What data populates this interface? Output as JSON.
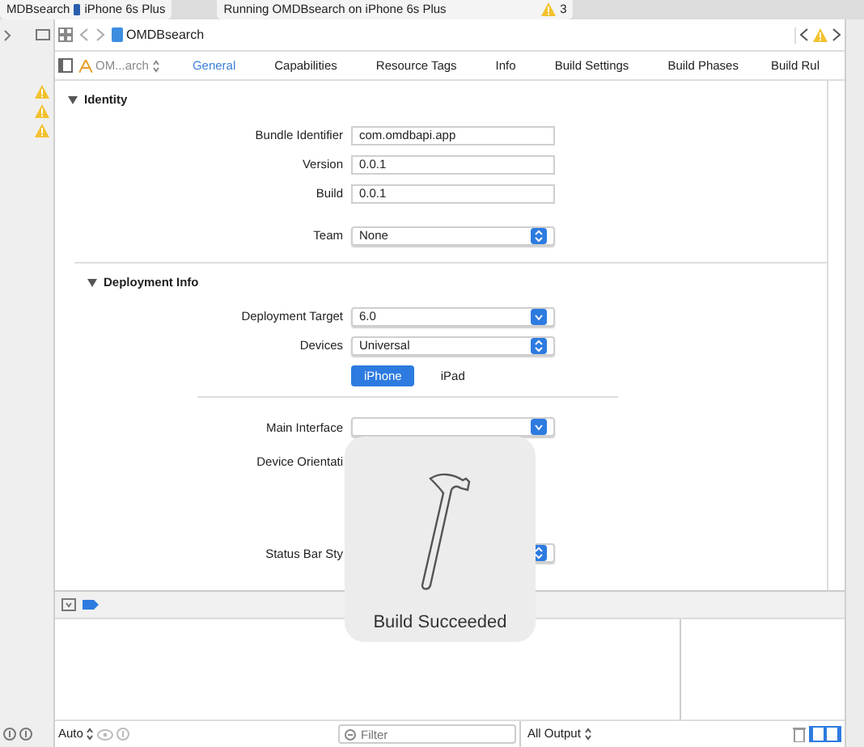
{
  "top_bar": {
    "scheme": "MDBsearch",
    "device": "iPhone 6s Plus",
    "activity": "Running OMDBsearch on iPhone 6s Plus",
    "warning_count": "3"
  },
  "jump_bar": {
    "file": "OMDBsearch"
  },
  "target_selector": "OM...arch",
  "tabs": [
    {
      "label": "General",
      "selected": true
    },
    {
      "label": "Capabilities",
      "selected": false
    },
    {
      "label": "Resource Tags",
      "selected": false
    },
    {
      "label": "Info",
      "selected": false
    },
    {
      "label": "Build Settings",
      "selected": false
    },
    {
      "label": "Build Phases",
      "selected": false
    },
    {
      "label": "Build Rul",
      "selected": false
    }
  ],
  "sections": [
    {
      "title": "Identity",
      "expanded": true,
      "rows": [
        {
          "kind": "text",
          "label": "Bundle Identifier",
          "value": "com.omdbapi.app"
        },
        {
          "kind": "text",
          "label": "Version",
          "value": "0.0.1"
        },
        {
          "kind": "text",
          "label": "Build",
          "value": "0.0.1"
        },
        {
          "kind": "popup",
          "label": "Team",
          "value": "None"
        }
      ]
    },
    {
      "title": "Deployment Info",
      "expanded": true,
      "rows": [
        {
          "kind": "combo",
          "label": "Deployment Target",
          "value": "6.0"
        },
        {
          "kind": "popup",
          "label": "Devices",
          "value": "Universal"
        },
        {
          "kind": "segmented",
          "options": [
            {
              "label": "iPhone",
              "selected": true
            },
            {
              "label": "iPad",
              "selected": false
            }
          ]
        },
        {
          "kind": "combo",
          "label": "Main Interface"
        },
        {
          "kind": "label",
          "label": "Device Orientati"
        },
        {
          "kind": "popup",
          "label": "Status Bar Sty"
        }
      ]
    }
  ],
  "hud": {
    "text": "Build Succeeded"
  },
  "bottom_bar": {
    "variables_mode": "Auto",
    "filter_placeholder": "Filter",
    "output_mode": "All Output"
  }
}
